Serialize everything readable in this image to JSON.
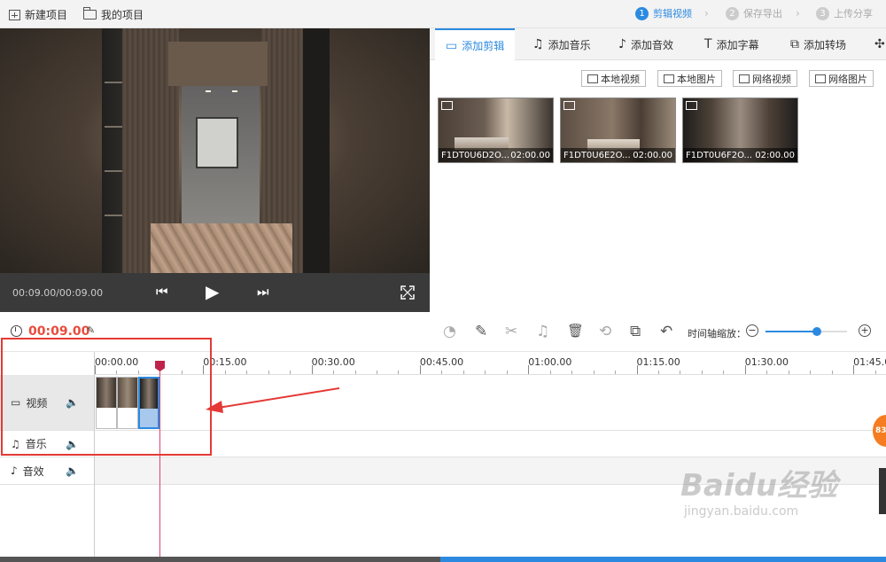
{
  "topbar": {
    "new_project": "新建项目",
    "my_projects": "我的项目",
    "steps": [
      {
        "num": "1",
        "label": "剪辑视频",
        "active": true
      },
      {
        "num": "2",
        "label": "保存导出",
        "active": false
      },
      {
        "num": "3",
        "label": "上传分享",
        "active": false
      }
    ]
  },
  "player": {
    "time": "00:09.00/00:09.00"
  },
  "tabs": [
    {
      "label": "添加剪辑",
      "icon": "video-camera-icon",
      "glyph": "▭"
    },
    {
      "label": "添加音乐",
      "icon": "music-note-icon",
      "glyph": "♫"
    },
    {
      "label": "添加音效",
      "icon": "sound-effect-icon",
      "glyph": "♪"
    },
    {
      "label": "添加字幕",
      "icon": "text-icon",
      "glyph": "T"
    },
    {
      "label": "添加转场",
      "icon": "transition-icon",
      "glyph": "⧉"
    },
    {
      "label": "",
      "icon": "more-icon",
      "glyph": "✣"
    }
  ],
  "source_buttons": [
    "本地视频",
    "本地图片",
    "网络视频",
    "网络图片"
  ],
  "media": [
    {
      "name": "F1DT0U6D2O...",
      "duration": "02:00.00"
    },
    {
      "name": "F1DT0U6E2O...",
      "duration": "02:00.00"
    },
    {
      "name": "F1DT0U6F2O...",
      "duration": "02:00.00"
    }
  ],
  "toolbar": {
    "total_time": "00:09.00",
    "zoom_label": "时间轴缩放：",
    "zoom_level": 0.63,
    "tools": [
      {
        "name": "speed-icon",
        "glyph": "◔",
        "enabled": false
      },
      {
        "name": "pencil-icon",
        "glyph": "✎",
        "enabled": true
      },
      {
        "name": "scissors-icon",
        "glyph": "✂",
        "enabled": false
      },
      {
        "name": "bell-icon",
        "glyph": "♫",
        "enabled": false
      },
      {
        "name": "delete-icon",
        "glyph": "🗑",
        "enabled": true
      },
      {
        "name": "crop-icon",
        "glyph": "⟲",
        "enabled": false
      },
      {
        "name": "copy-icon",
        "glyph": "⧉",
        "enabled": true
      },
      {
        "name": "undo-icon",
        "glyph": "↶",
        "enabled": true
      }
    ]
  },
  "timeline": {
    "ticks": [
      "00:00.00",
      "00:15.00",
      "00:30.00",
      "00:45.00",
      "01:00.00",
      "01:15.00",
      "01:30.00",
      "01:45.00"
    ],
    "tracks": [
      {
        "label": "视频",
        "icon": "video-camera-icon"
      },
      {
        "label": "音乐",
        "icon": "music-note-icon"
      },
      {
        "label": "音效",
        "icon": "sound-effect-icon"
      }
    ]
  },
  "float_badge": "83",
  "watermark": {
    "main": "Baidu经验",
    "sub": "jingyan.baidu.com"
  }
}
